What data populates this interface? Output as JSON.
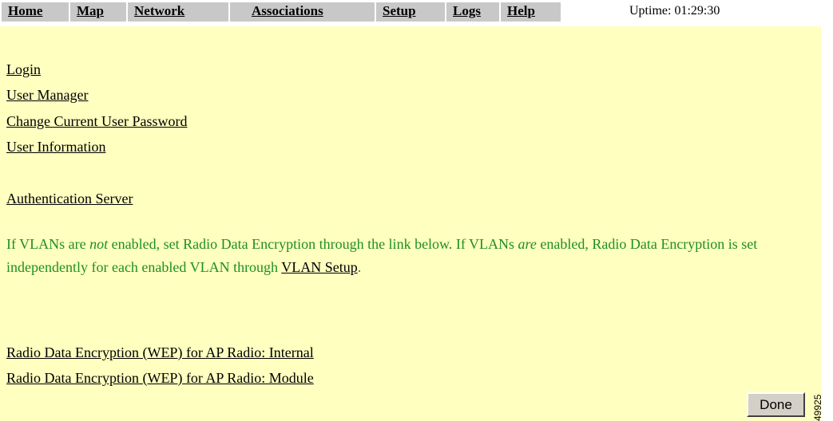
{
  "nav": {
    "tabs": [
      {
        "label": "Home"
      },
      {
        "label": "Map"
      },
      {
        "label": "Network"
      },
      {
        "label": "Associations"
      },
      {
        "label": "Setup"
      },
      {
        "label": "Logs"
      },
      {
        "label": "Help"
      }
    ],
    "uptime_label": "Uptime:",
    "uptime_value": "01:29:30"
  },
  "links": {
    "login": "Login",
    "user_manager": "User Manager",
    "change_password": "Change Current User Password",
    "user_information": "User Information",
    "authentication_server": "Authentication Server",
    "wep_internal": "Radio Data Encryption (WEP) for AP Radio: Internal",
    "wep_module": "Radio Data Encryption (WEP) for AP Radio: Module"
  },
  "note": {
    "part1": "If VLANs are ",
    "not": "not",
    "part2": " enabled, set Radio Data Encryption through the link below. If VLANs ",
    "are": "are",
    "part3": " enabled, Radio Data Encryption is set independently for each enabled VLAN through ",
    "vlan_setup_link": "VLAN Setup",
    "part4": "."
  },
  "done_button": "Done",
  "figure_id": "49925",
  "colors": {
    "page_background": "#ffffc0",
    "tab_background": "#c8c8c8",
    "note_text": "#1f8f1f"
  }
}
